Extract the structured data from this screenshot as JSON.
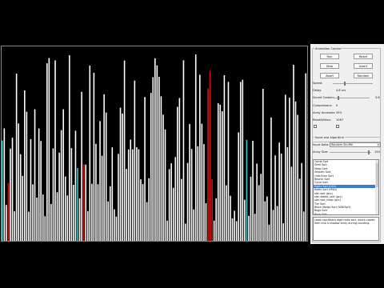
{
  "colors": {
    "bar": "#ffffff",
    "highlight_red": "#d21414",
    "highlight_cyan": "#40c8c8",
    "background": "#000000",
    "panel": "#f0f0f0"
  },
  "animation": {
    "title": "Animation Control",
    "buttons": {
      "run": "Run",
      "reset": "Reset",
      "step": "Step",
      "insert": "Insert",
      "abort": "Abort",
      "random": "Random"
    },
    "speed_label": "Speed:",
    "delay_label": "Delay:",
    "delay_value": "4.8 ms",
    "sound_label": "Sound Sustain:",
    "sound_value": "3.8",
    "comparisons_label": "Comparisons:",
    "comparisons_value": "0",
    "array_accesses_label": "Array Accesses:",
    "array_accesses_value": "393",
    "swaps_label": "Read/Writes:",
    "swaps_value": "1087"
  },
  "input": {
    "title": "Input and Algorithm",
    "input_data_label": "Input Data:",
    "input_data_value": "Random Shuffle",
    "array_size_label": "Array Size:",
    "array_size_value": "150",
    "algorithms": [
      "Comb Sort",
      "Shell Sort",
      "Heap Sort",
      "Smooth Sort",
      "Odd-Even Sort",
      "Bitonic Sort",
      "Cycle Sort",
      "Radix Sort (LSD)",
      "Radix Sort (MSD)",
      "std::sort (gcc)",
      "std::stable_sort (gcc)",
      "std::sort_heap (gcc)",
      "Tim Sort",
      "Block Merge Sort (WikiSort)",
      "Bogo Sort",
      "Bozo Sort"
    ],
    "selected_index": 7,
    "description": "Least significant digit radix sort, which copies item into a shadow array during counting."
  }
}
